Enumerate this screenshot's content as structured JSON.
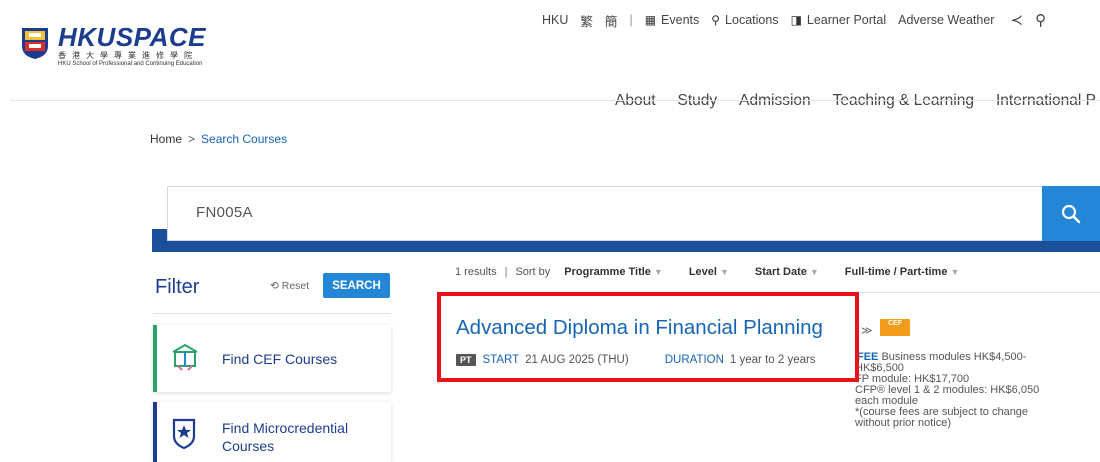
{
  "header": {
    "logo_name": "HKUSPACE",
    "logo_chinese": "香港大學專業進修學院",
    "logo_english": "HKU School of Professional and Continuing Education",
    "utility": {
      "hku": "HKU",
      "trad": "繁",
      "simp": "簡",
      "sep": "|",
      "events": "Events",
      "locations": "Locations",
      "learner_portal": "Learner Portal",
      "adverse_weather": "Adverse Weather"
    },
    "nav": [
      "About",
      "Study",
      "Admission",
      "Teaching & Learning",
      "International P"
    ]
  },
  "breadcrumb": {
    "home": "Home",
    "sep": ">",
    "current": "Search Courses"
  },
  "search": {
    "value": "FN005A"
  },
  "filter": {
    "title": "Filter",
    "reset": "Reset",
    "search_button": "SEARCH",
    "cards": [
      {
        "label": "Find CEF Courses"
      },
      {
        "label": "Find Microcredential Courses"
      }
    ]
  },
  "results": {
    "count": "1 results",
    "sep": "|",
    "sort_label": "Sort by",
    "sort_options": [
      "Programme Title",
      "Level",
      "Start Date",
      "Full-time / Part-time"
    ],
    "course": {
      "title": "Advanced Diploma in Financial Planning",
      "badge": "CEF",
      "mode": "PT",
      "start_label": "START",
      "start_value": "21 AUG 2025 (THU)",
      "duration_label": "DURATION",
      "duration_value": "1 year to 2 years",
      "fee_label": "FEE",
      "fee_lines": [
        "Business modules HK$4,500-",
        "HK$6,500",
        "FP module: HK$17,700",
        "CFP® level 1 & 2 modules: HK$6,050",
        "each module",
        "*(course fees are subject to change",
        "without prior notice)"
      ]
    }
  },
  "colors": {
    "brand_blue": "#1c3d8f",
    "link_blue": "#1565b7",
    "button_blue": "#2386d6",
    "highlight_red": "#e8131a",
    "cef_green": "#2aa36b"
  }
}
